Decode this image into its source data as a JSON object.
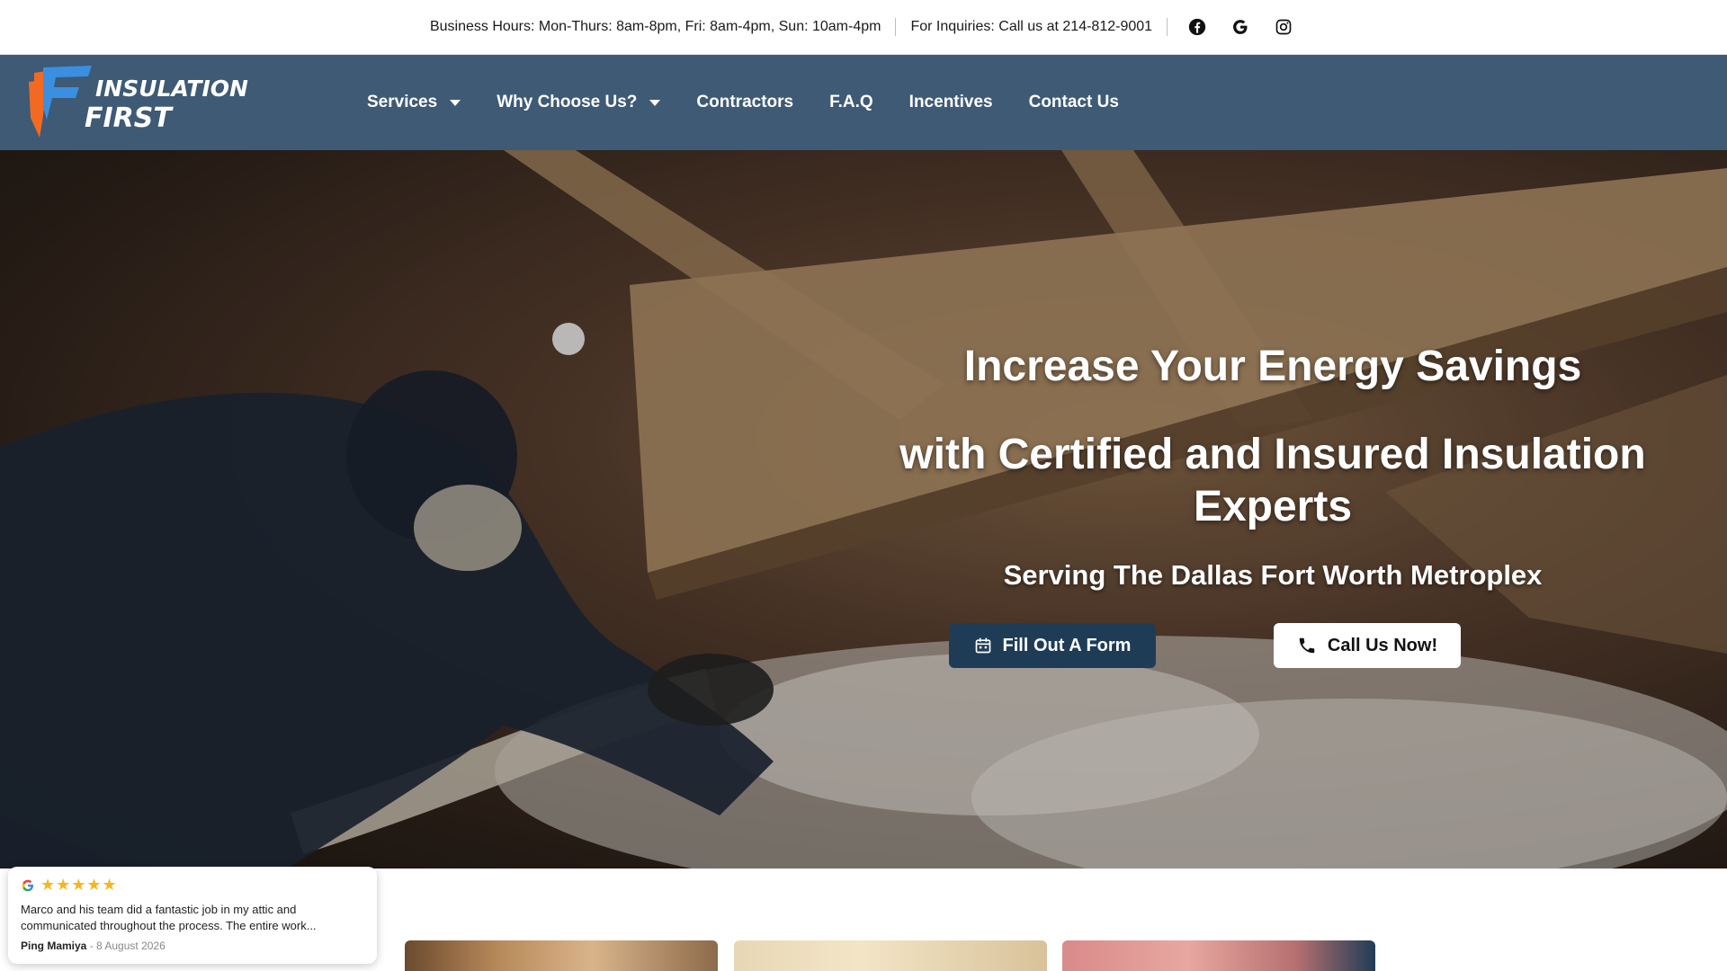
{
  "topbar": {
    "hours": "Business Hours: Mon-Thurs: 8am-8pm, Fri: 8am-4pm, Sun: 10am-4pm",
    "inquiries": "For Inquiries: Call us at 214-812-9001",
    "social_icons": [
      "facebook-icon",
      "google-icon",
      "instagram-icon"
    ]
  },
  "brand": {
    "logo_line1": "INSULATION",
    "logo_line2": "FIRST",
    "colors": {
      "nav_bg": "#3e5a75",
      "accent_orange": "#f26a21",
      "accent_blue": "#3b8fe0",
      "button_dark": "#1f3c57"
    }
  },
  "nav": {
    "items": [
      {
        "label": "Services",
        "dropdown": true
      },
      {
        "label": "Why Choose Us?",
        "dropdown": true
      },
      {
        "label": "Contractors",
        "dropdown": false
      },
      {
        "label": "F.A.Q",
        "dropdown": false
      },
      {
        "label": "Incentives",
        "dropdown": false
      },
      {
        "label": "Contact Us",
        "dropdown": false
      }
    ]
  },
  "hero": {
    "headline_1": "Increase Your Energy Savings",
    "headline_2": "with Certified and Insured Insulation Experts",
    "subheadline": "Serving The Dallas Fort Worth Metroplex",
    "buttons": {
      "form_label": "Fill Out A Form",
      "form_icon": "calendar-icon",
      "call_label": "Call Us Now!",
      "call_icon": "phone-icon"
    }
  },
  "review": {
    "source_icon": "google-icon",
    "stars": "★★★★★",
    "rating": 5,
    "text": "Marco and his team did a fantastic job in my attic and communicated throughout the process. The entire work...",
    "author": "Ping Mamiya",
    "date": "- 8 August 2026"
  }
}
